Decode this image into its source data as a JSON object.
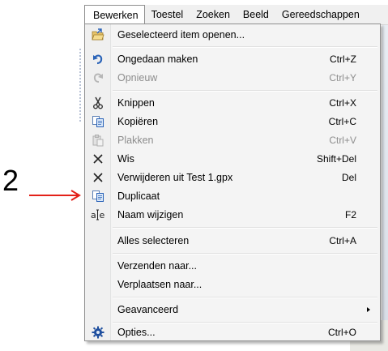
{
  "menubar": {
    "items": [
      {
        "label": "Bewerken",
        "active": true
      },
      {
        "label": "Toestel",
        "active": false
      },
      {
        "label": "Zoeken",
        "active": false
      },
      {
        "label": "Beeld",
        "active": false
      },
      {
        "label": "Gereedschappen",
        "active": false
      }
    ]
  },
  "menu": {
    "open_selected": {
      "label": "Geselecteerd item openen...",
      "icon": "open-folder-icon"
    },
    "undo": {
      "label": "Ongedaan maken",
      "shortcut": "Ctrl+Z",
      "icon": "undo-icon"
    },
    "redo": {
      "label": "Opnieuw",
      "shortcut": "Ctrl+Y",
      "icon": "redo-icon",
      "disabled": true
    },
    "cut": {
      "label": "Knippen",
      "shortcut": "Ctrl+X",
      "icon": "scissors-icon"
    },
    "copy": {
      "label": "Kopiëren",
      "shortcut": "Ctrl+C",
      "icon": "copy-icon"
    },
    "paste": {
      "label": "Plakken",
      "shortcut": "Ctrl+V",
      "icon": "paste-icon",
      "disabled": true
    },
    "delete": {
      "label": "Wis",
      "shortcut": "Shift+Del",
      "icon": "x-icon"
    },
    "remove_from": {
      "label": "Verwijderen uit Test 1.gpx",
      "shortcut": "Del",
      "icon": "x-icon"
    },
    "duplicate": {
      "label": "Duplicaat",
      "icon": "duplicate-icon"
    },
    "rename": {
      "label": "Naam wijzigen",
      "shortcut": "F2",
      "icon": "rename-icon"
    },
    "select_all": {
      "label": "Alles selecteren",
      "shortcut": "Ctrl+A"
    },
    "send_to": {
      "label": "Verzenden naar..."
    },
    "move_to": {
      "label": "Verplaatsen naar..."
    },
    "advanced": {
      "label": "Geavanceerd",
      "has_submenu": true
    },
    "options": {
      "label": "Opties...",
      "shortcut": "Ctrl+O",
      "icon": "gear-icon"
    }
  },
  "annotation": {
    "number": "2",
    "arrow_color": "#e32119"
  },
  "colors": {
    "menu_bg": "#f4f4f4",
    "disabled_text": "#8d8d8d",
    "icon_blue": "#2a63b8"
  }
}
